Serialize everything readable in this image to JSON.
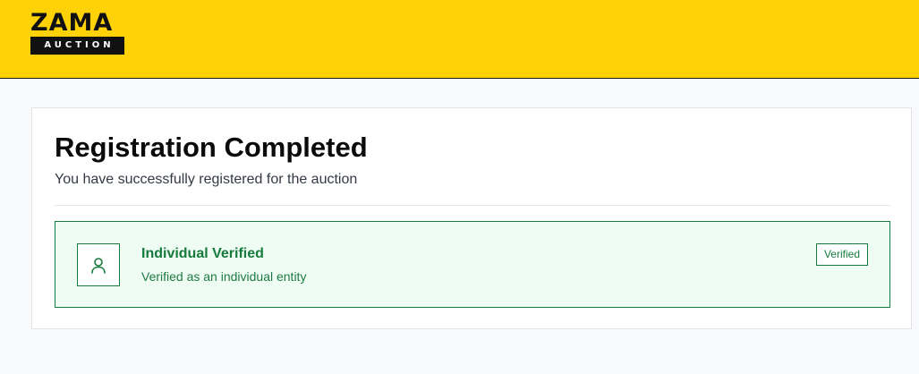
{
  "brand": {
    "name": "ZAMA",
    "subtitle": "AUCTION"
  },
  "registration": {
    "title": "Registration Completed",
    "subtitle": "You have successfully registered for the auction"
  },
  "verification": {
    "icon": "user-icon",
    "title": "Individual Verified",
    "description": "Verified as an individual entity",
    "badge": "Verified"
  },
  "colors": {
    "header_bg": "#ffd208",
    "success_green": "#157a3c",
    "success_bg": "#effcf3"
  }
}
